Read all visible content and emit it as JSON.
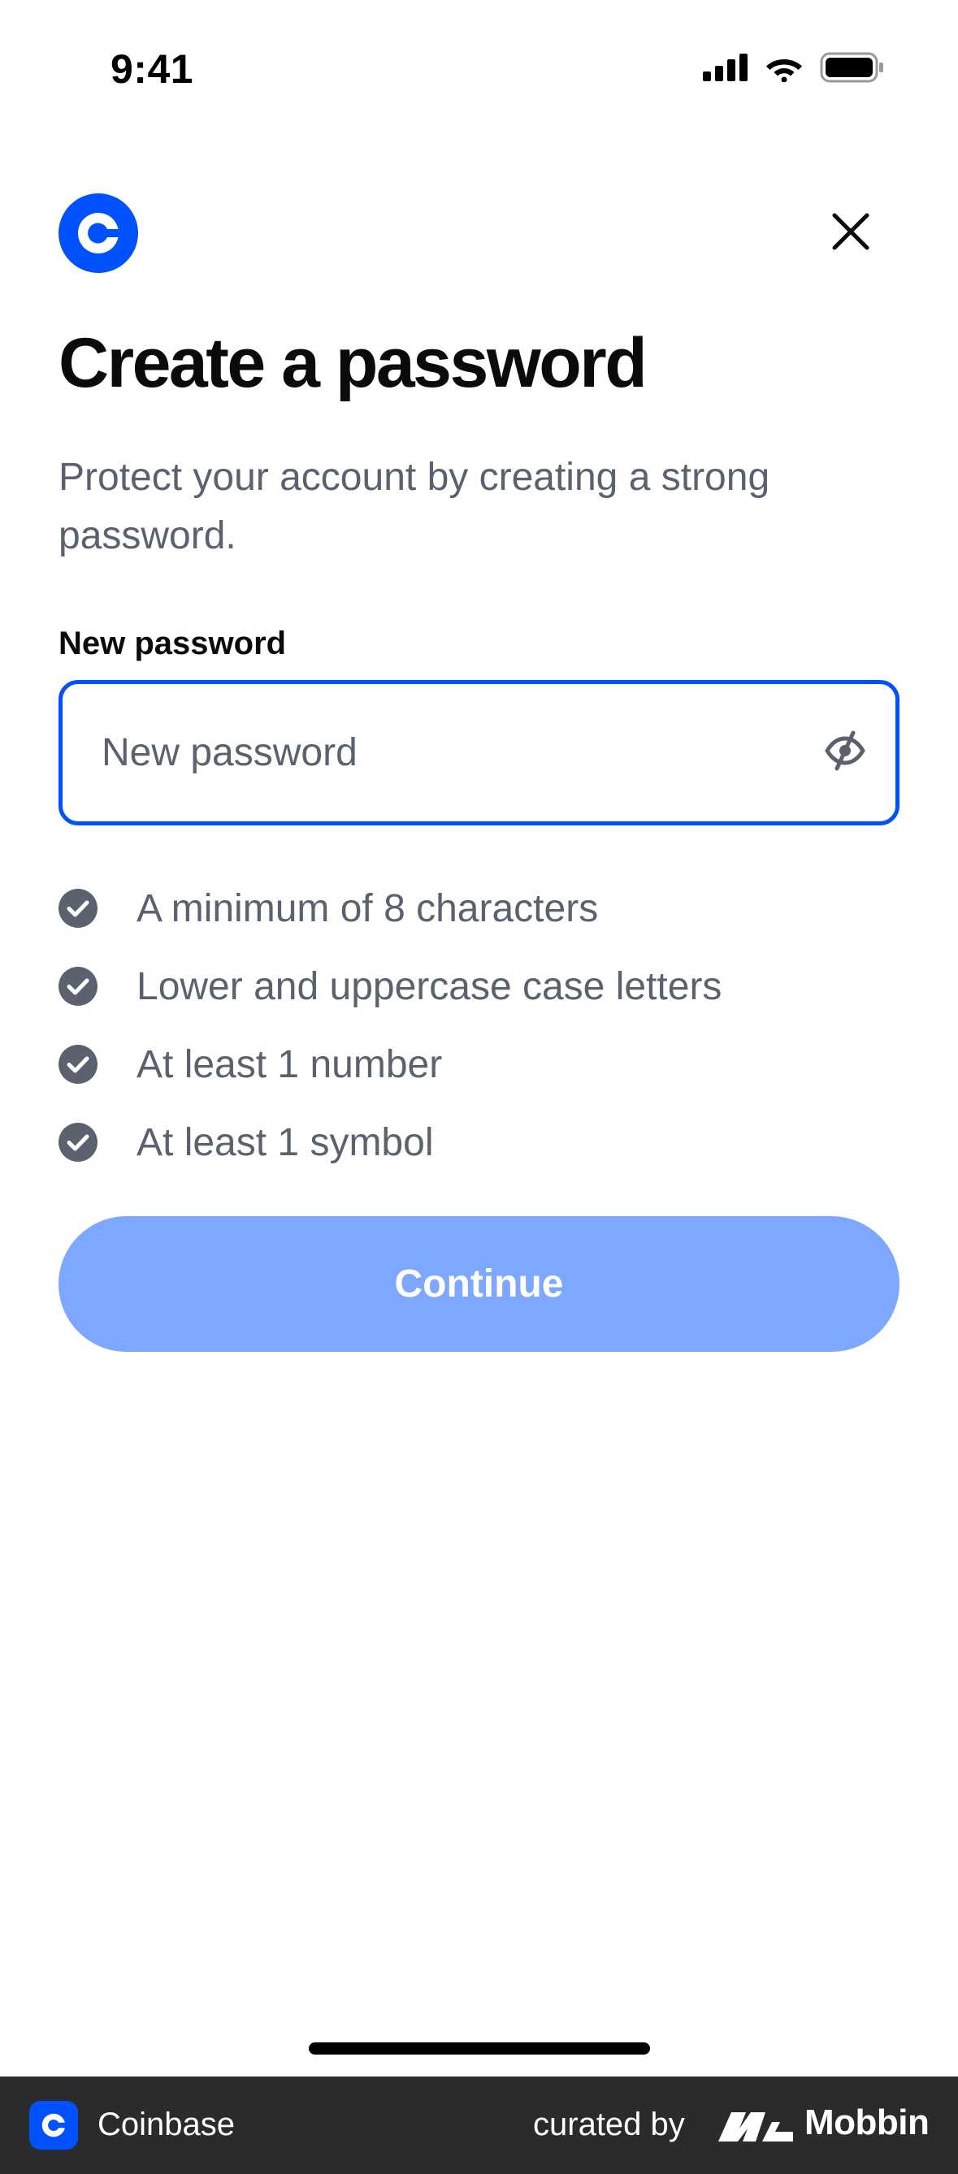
{
  "status_bar": {
    "time": "9:41",
    "icons": [
      "signal-icon",
      "wifi-icon",
      "battery-icon"
    ]
  },
  "header": {
    "logo_icon": "coinbase-logo-icon",
    "close_icon": "close-icon"
  },
  "title": "Create a password",
  "subtitle": "Protect your account by creating a strong password.",
  "password_field": {
    "label": "New password",
    "placeholder": "New password",
    "value": "",
    "toggle_icon": "eye-off-icon"
  },
  "requirements": [
    {
      "text": "A minimum of 8 characters",
      "icon": "check-circle-icon"
    },
    {
      "text": "Lower and uppercase case letters",
      "icon": "check-circle-icon"
    },
    {
      "text": "At least 1 number",
      "icon": "check-circle-icon"
    },
    {
      "text": "At least 1 symbol",
      "icon": "check-circle-icon"
    }
  ],
  "continue_label": "Continue",
  "footer": {
    "app_name": "Coinbase",
    "curated_by": "curated by",
    "brand": "Mobbin"
  },
  "colors": {
    "brand_blue": "#0052ff",
    "button_disabled": "#7ea8ff",
    "muted_text": "#5b616e",
    "check_icon": "#5b616e",
    "footer_bg": "#2b2b2d"
  }
}
